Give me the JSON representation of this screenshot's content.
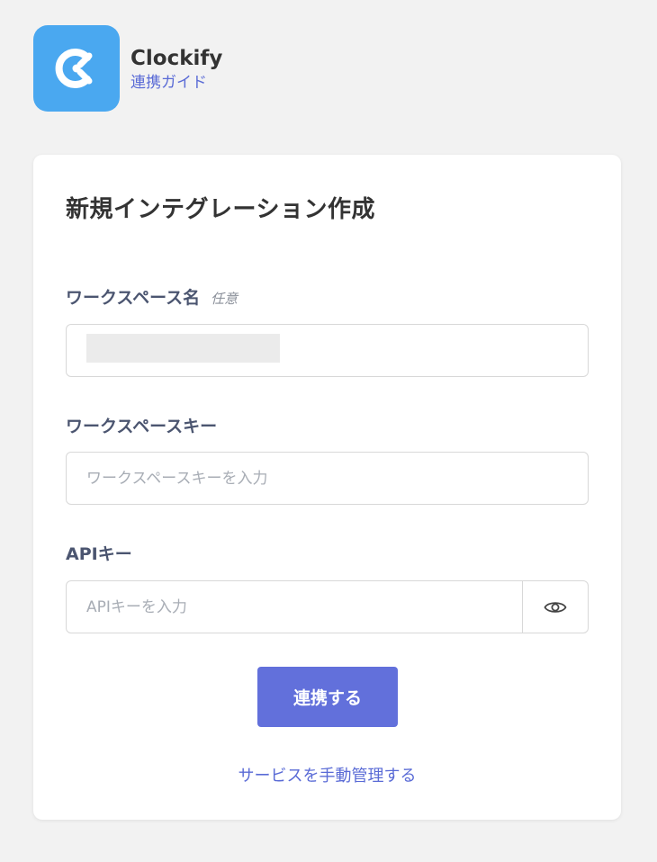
{
  "header": {
    "app_name": "Clockify",
    "guide_link": "連携ガイド"
  },
  "form": {
    "title": "新規インテグレーション作成",
    "workspace_name": {
      "label": "ワークスペース名",
      "optional": "任意"
    },
    "workspace_key": {
      "label": "ワークスペースキー",
      "placeholder": "ワークスペースキーを入力"
    },
    "api_key": {
      "label": "APIキー",
      "placeholder": "APIキーを入力"
    },
    "submit_label": "連携する",
    "manual_link": "サービスを手動管理する"
  },
  "colors": {
    "logo_bg": "#4aa8f0",
    "primary": "#6270db",
    "link": "#5a6bd6"
  },
  "icons": {
    "logo": "clockify-logo-icon",
    "password_toggle": "eye-icon"
  }
}
